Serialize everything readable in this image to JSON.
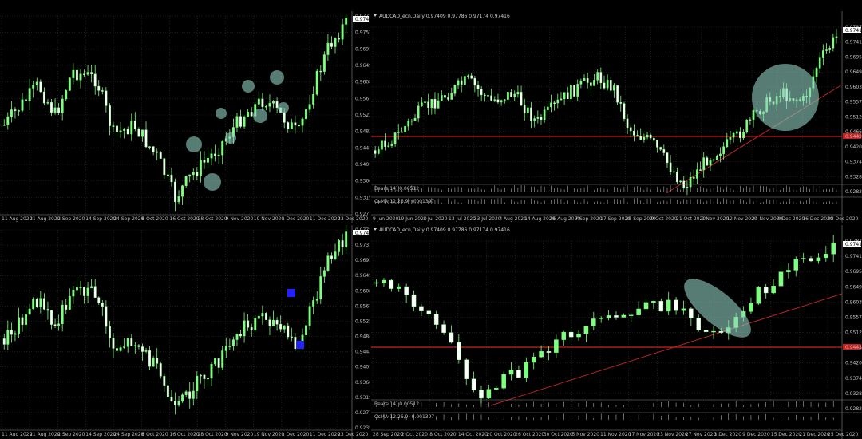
{
  "colors": {
    "background": "#000000",
    "bull": "#7fff7f",
    "bear": "#ffffff",
    "wick": "#7fff7f",
    "grid": "#3a3a3a",
    "support": "#c81e1e",
    "trend": "#b82525",
    "highlight": "#8fcfc0",
    "marker": "#2222ff",
    "text": "#bfbfbf"
  },
  "panels": [
    {
      "id": "top-left",
      "header": "",
      "indicator_rows": [],
      "price_ticks": [
        "0.97730",
        "0.97520",
        "0.96910",
        "0.96490",
        "0.96080",
        "0.95670",
        "0.95230",
        "0.94820",
        "0.94410",
        "0.94010",
        "0.93600",
        "0.93190",
        "0.92770"
      ],
      "current_price": "0.97416",
      "date_ticks": [
        "11 Aug 2020",
        "21 Aug 2020",
        "2 Sep 2020",
        "14 Sep 2020",
        "24 Sep 2020",
        "6 Oct 2020",
        "16 Oct 2020",
        "28 Oct 2020",
        "9 Nov 2020",
        "19 Nov 2020",
        "1 Dec 2020",
        "11 Dec 2020",
        "23 Dec 2020"
      ]
    },
    {
      "id": "top-right",
      "header": "AUDCAD_ecn,Daily 0.97409 0.97786 0.97174 0.97416",
      "indicator_rows": [
        "Bears(14) 0.00512",
        "OsMA(12,26,9) 0.001397"
      ],
      "price_ticks": [
        "0.97870",
        "0.97410",
        "0.96950",
        "0.96490",
        "0.96030",
        "0.95570",
        "0.95120",
        "0.94660",
        "0.94200",
        "0.93740",
        "0.93280",
        "0.92820"
      ],
      "current_price": "0.97416",
      "support_price": "0.94434",
      "date_ticks": [
        "9 Jun 2020",
        "19 Jun 2020",
        "1 Jul 2020",
        "13 Jul 2020",
        "23 Jul 2020",
        "4 Aug 2020",
        "14 Aug 2020",
        "26 Aug 2020",
        "7 Sep 2020",
        "17 Sep 2020",
        "29 Sep 2020",
        "9 Oct 2020",
        "21 Oct 2020",
        "2 Nov 2020",
        "12 Nov 2020",
        "24 Nov 2020",
        "4 Dec 2020",
        "16 Dec 2020",
        "28 Dec 2020"
      ]
    },
    {
      "id": "bottom-left",
      "header": "",
      "indicator_rows": [],
      "price_ticks": [
        "0.97730",
        "0.97310",
        "0.96910",
        "0.96490",
        "0.96080",
        "0.95670",
        "0.95250",
        "0.94840",
        "0.94430",
        "0.94010",
        "0.93600",
        "0.93190",
        "0.92770",
        "0.92350"
      ],
      "current_price": "0.97416",
      "date_ticks": [
        "11 Aug 2020",
        "21 Aug 2020",
        "2 Sep 2020",
        "14 Sep 2020",
        "24 Sep 2020",
        "6 Oct 2020",
        "16 Oct 2020",
        "28 Oct 2020",
        "9 Nov 2020",
        "19 Nov 2020",
        "1 Dec 2020",
        "11 Dec 2020",
        "23 Dec 2020"
      ]
    },
    {
      "id": "bottom-right",
      "header": "AUDCAD_ecn,Daily 0.97409 0.97786 0.97174 0.97416",
      "indicator_rows": [
        "Bears(14) 0.00512",
        "OsMA(12,26,9) 0.001397"
      ],
      "price_ticks": [
        "0.97870",
        "0.97410",
        "0.96950",
        "0.96490",
        "0.96030",
        "0.95570",
        "0.95120",
        "0.94660",
        "0.94200",
        "0.93740",
        "0.93280",
        "0.92820"
      ],
      "current_price": "0.97416",
      "support_price": "0.94434",
      "date_ticks": [
        "28 Sep 2020",
        "2 Oct 2020",
        "8 Oct 2020",
        "14 Oct 2020",
        "20 Oct 2020",
        "26 Oct 2020",
        "30 Oct 2020",
        "5 Nov 2020",
        "11 Nov 2020",
        "17 Nov 2020",
        "23 Nov 2020",
        "27 Nov 2020",
        "3 Dec 2020",
        "9 Dec 2020",
        "15 Dec 2020",
        "21 Dec 2020",
        "25 Dec 2020"
      ]
    }
  ],
  "chart_data": [
    {
      "type": "candlestick",
      "panel": "top-left",
      "title": "",
      "ylim": [
        0.9277,
        0.9773
      ],
      "x_range": [
        "11 Aug 2020",
        "23 Dec 2020"
      ],
      "last_close": 0.97416,
      "grid": true
    },
    {
      "type": "candlestick",
      "panel": "top-right",
      "title": "AUDCAD_ecn,Daily",
      "ylim": [
        0.9282,
        0.9787
      ],
      "x_range": [
        "9 Jun 2020",
        "28 Dec 2020"
      ],
      "ohlc_last": {
        "open": 0.97409,
        "high": 0.97786,
        "low": 0.97174,
        "close": 0.97416
      },
      "support_level": 0.94434,
      "grid": true
    },
    {
      "type": "candlestick",
      "panel": "bottom-left",
      "title": "",
      "ylim": [
        0.9235,
        0.9773
      ],
      "x_range": [
        "11 Aug 2020",
        "23 Dec 2020"
      ],
      "last_close": 0.97416,
      "grid": true
    },
    {
      "type": "candlestick",
      "panel": "bottom-right",
      "title": "AUDCAD_ecn,Daily",
      "ylim": [
        0.9282,
        0.9787
      ],
      "x_range": [
        "28 Sep 2020",
        "25 Dec 2020"
      ],
      "ohlc_last": {
        "open": 0.97409,
        "high": 0.97786,
        "low": 0.97174,
        "close": 0.97416
      },
      "support_level": 0.94434,
      "grid": true
    }
  ]
}
